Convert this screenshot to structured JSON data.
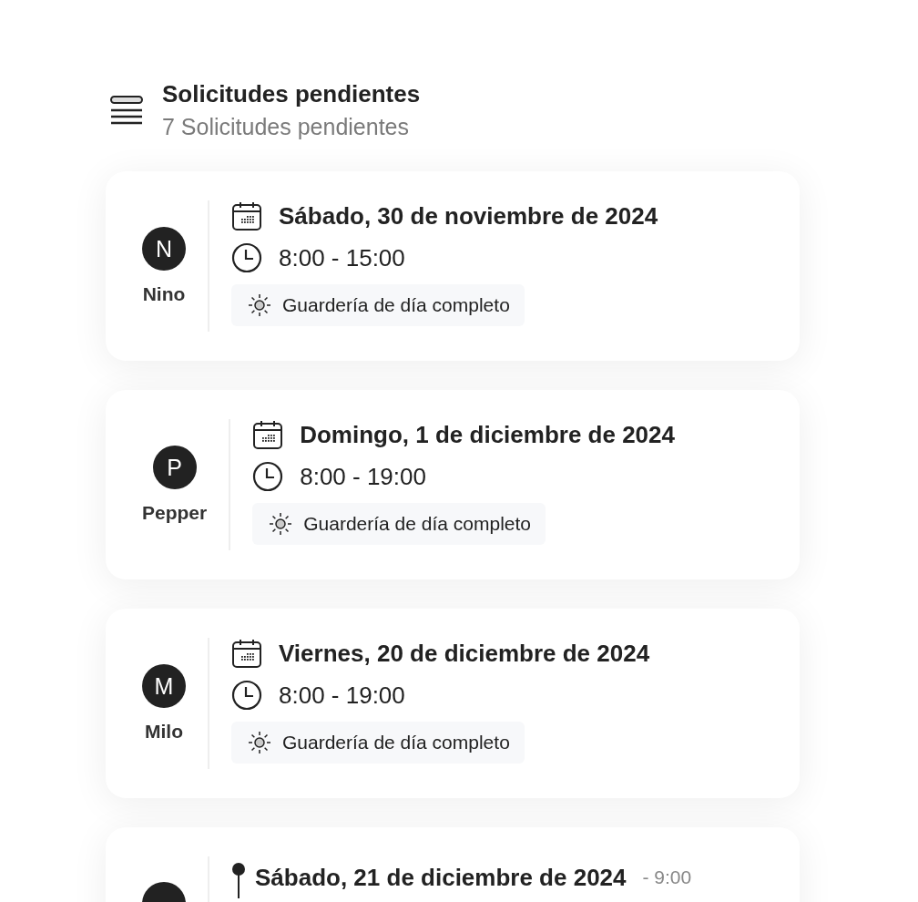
{
  "header": {
    "title": "Solicitudes pendientes",
    "subtitle": "7 Solicitudes pendientes"
  },
  "requests": [
    {
      "kind": "single",
      "initial": "N",
      "name": "Nino",
      "date": "Sábado, 30 de noviembre de 2024",
      "time": "8:00 - 15:00",
      "service": "Guardería de día completo"
    },
    {
      "kind": "single",
      "initial": "P",
      "name": "Pepper",
      "date": "Domingo, 1 de diciembre de 2024",
      "time": "8:00 - 19:00",
      "service": "Guardería de día completo"
    },
    {
      "kind": "single",
      "initial": "M",
      "name": "Milo",
      "date": "Viernes, 20 de diciembre de 2024",
      "time": "8:00 - 19:00",
      "service": "Guardería de día completo"
    },
    {
      "kind": "range",
      "date": "Sábado, 21 de diciembre de 2024",
      "time": "- 9:00"
    }
  ]
}
